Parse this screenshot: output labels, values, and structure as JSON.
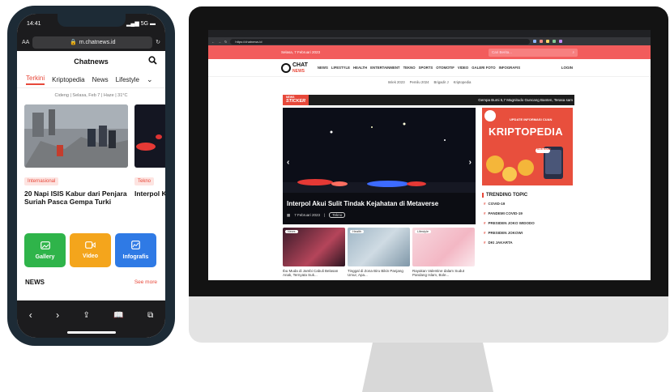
{
  "phone": {
    "status": {
      "time": "14:41",
      "signal": "5G"
    },
    "url_bar": {
      "text_size": "AA",
      "url": "m.chatnews.id"
    },
    "site_title": "Chatnews",
    "tabs": [
      "Terkini",
      "Kriptopedia",
      "News",
      "Lifestyle"
    ],
    "location_line": "Cideng | Selasa, Feb 7 | Haze | 31°C",
    "cards": [
      {
        "badge": "Internasional",
        "title": "20 Napi ISIS Kabur dari Penjara Suriah Pasca Gempa Turki"
      },
      {
        "badge": "Tekno",
        "title": "Interpol Kejaha"
      }
    ],
    "buttons": [
      {
        "label": "Gallery",
        "color": "#2fb44a"
      },
      {
        "label": "Video",
        "color": "#f4a51c"
      },
      {
        "label": "Infografis",
        "color": "#2f7ae5"
      }
    ],
    "news_section": {
      "label": "NEWS",
      "more": "See more"
    }
  },
  "desktop": {
    "address": "https://chatnews.id",
    "topbar": {
      "date": "Selasa, 7 Februari 2023",
      "search_placeholder": "Cari Berita..."
    },
    "logo": {
      "main": "CHAT",
      "sub": "NEWS"
    },
    "nav": [
      "NEWS",
      "LIFESTYLE",
      "HEALTH",
      "ENTERTAINMENT",
      "TEKNO",
      "SPORTS",
      "OTOMOTIF",
      "VIDEO",
      "GALERI FOTO",
      "INFOGRAFIS"
    ],
    "login": "LOGIN",
    "tags": [
      "Imlek 2023",
      "Pemilu 2024",
      "Brigadir J",
      "Kriptopedia"
    ],
    "sticker": {
      "tag_top": "NEWS",
      "tag_bottom": "STICKER",
      "text": "Gempa Bumi 5,7 Magnitudo Guncang Banten, Terasa sam"
    },
    "hero": {
      "title": "Interpol Akui Sulit Tindak Kejahatan di Metaverse",
      "date": "7 Februari 2023",
      "category": "Tekno"
    },
    "ad": {
      "subtitle": "UPDATE INFORMASI CUAN",
      "title": "KRIPTOPEDIA",
      "cta": "KLIK DISINI"
    },
    "trending": {
      "heading": "TRENDING TOPIC",
      "items": [
        "COVID-19",
        "PANDEMI COVID-19",
        "PRESIDEN JOKO WIDODO",
        "PRESIDEN JOKOWI",
        "DKI JAKARTA"
      ]
    },
    "thumbs": [
      {
        "category": "News",
        "title": "Ibu Muda di Jambi Cabuli Belasan Anak, Ternyata Suk..."
      },
      {
        "category": "Health",
        "title": "Tinggal di Zona Biru Bikin Panjang Umur, Apa..."
      },
      {
        "category": "Lifestyle",
        "title": "Rayakan Valentine dalam Sudut Pandang Islam, Bole..."
      }
    ]
  }
}
